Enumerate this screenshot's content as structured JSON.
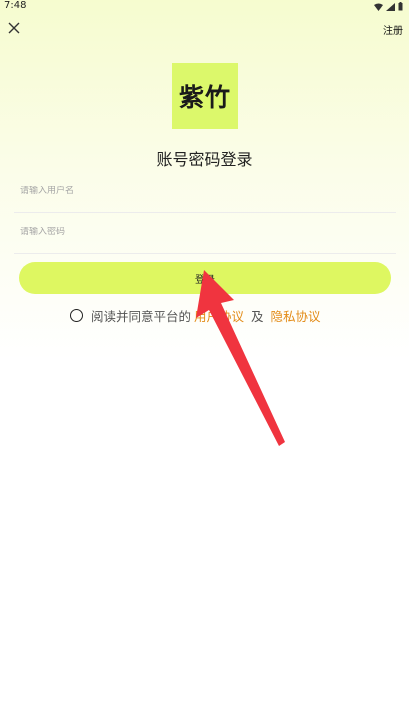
{
  "status_bar": {
    "time": "7:48",
    "icons": [
      "wifi-icon",
      "signal-icon",
      "battery-icon"
    ]
  },
  "header": {
    "close_icon": "close-icon",
    "register_label": "注册"
  },
  "logo": {
    "text": "紫竹"
  },
  "title": "账号密码登录",
  "form": {
    "username_placeholder": "请输入用户名",
    "username_value": "",
    "password_placeholder": "请输入密码",
    "password_value": ""
  },
  "login_button": "登录",
  "agreement": {
    "prefix": "阅读并同意平台的",
    "user_agreement": "用户协议",
    "and": "及",
    "privacy_policy": "隐私协议",
    "checked": false
  },
  "colors": {
    "accent": "#def761",
    "logo_bg": "#dcf86b",
    "link": "#e38b17",
    "annotation_arrow": "#f0343f"
  }
}
